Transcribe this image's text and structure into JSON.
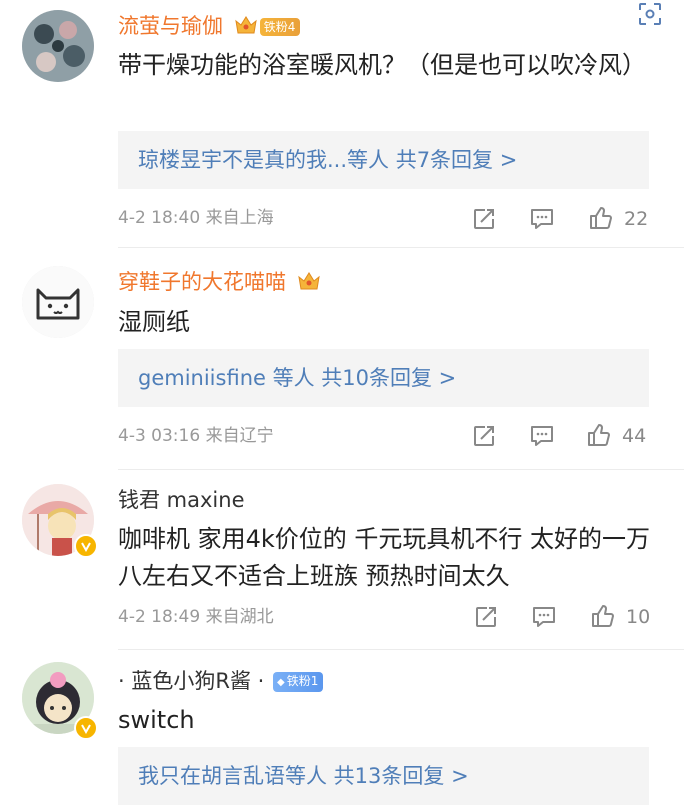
{
  "comments": [
    {
      "username": "流萤与瑜伽",
      "fan_badge": "铁粉4",
      "text": "带干燥功能的浴室暖风机？（但是也可以吹冷风）",
      "replies": "琼楼昱宇不是真的我...等人  共7条回复 >",
      "time_location": "4-2 18:40  来自上海",
      "likes": "22"
    },
    {
      "username": "穿鞋子的大花喵喵",
      "text": "湿厕纸",
      "replies": "geminiisfine 等人  共10条回复 >",
      "time_location": "4-3 03:16  来自辽宁",
      "likes": "44"
    },
    {
      "username": "钱君 maxine",
      "text": "咖啡机 家用4k价位的 千元玩具机不行 太好的一万八左右又不适合上班族 预热时间太久",
      "time_location": "4-2 18:49  来自湖北",
      "likes": "10"
    },
    {
      "username": "· 蓝色小狗R酱 ·",
      "fan_badge": "铁粉1",
      "text": "switch",
      "replies": "我只在胡言乱语等人  共13条回复 >"
    }
  ],
  "colors": {
    "vip_name": "#f0772d",
    "link": "#4f7eb8",
    "meta": "#999999"
  },
  "icons": [
    "scan-icon",
    "crown-icon",
    "share-icon",
    "comment-icon",
    "like-icon",
    "verified-v-icon"
  ]
}
